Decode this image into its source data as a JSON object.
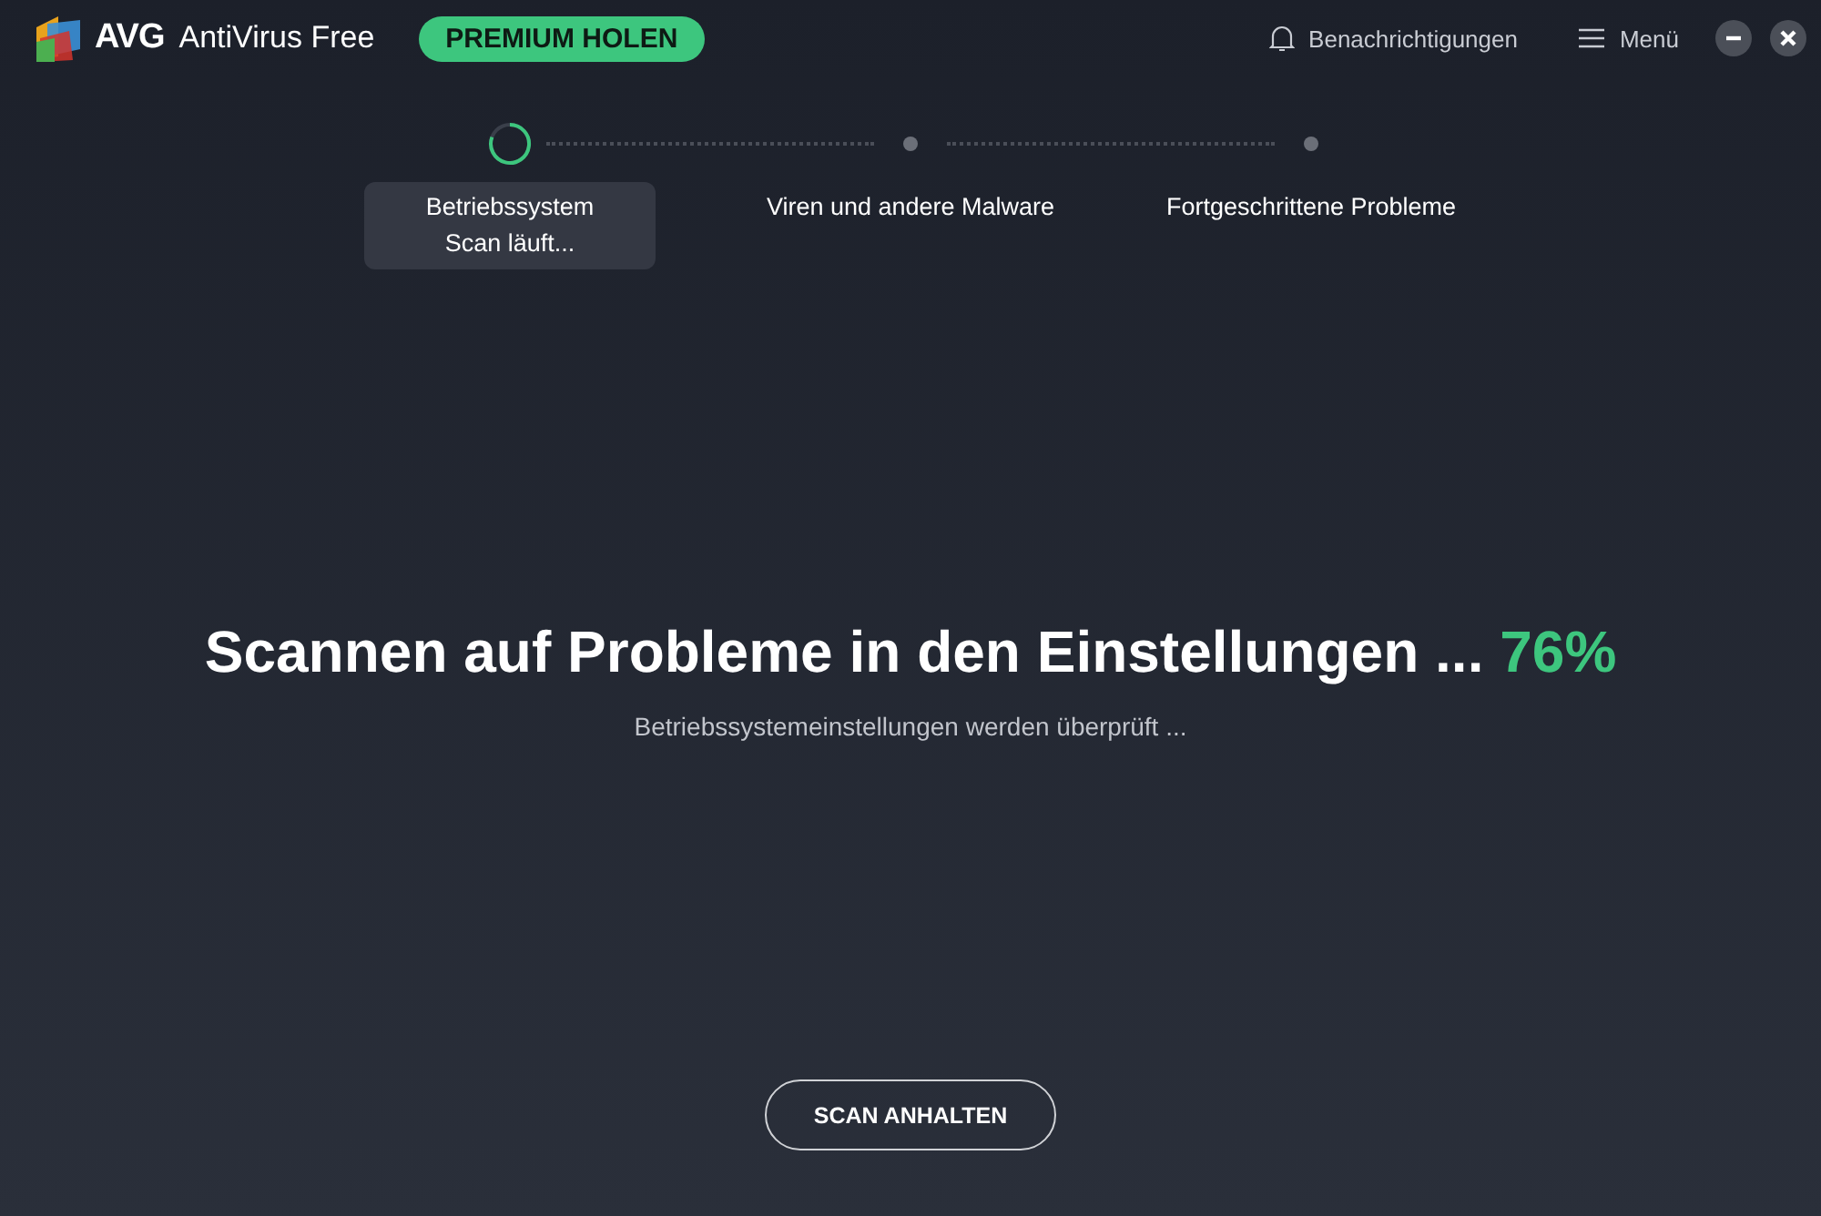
{
  "header": {
    "brand": "AVG",
    "product": "AntiVirus Free",
    "premium_button": "PREMIUM HOLEN",
    "notifications": "Benachrichtigungen",
    "menu": "Menü"
  },
  "steps": [
    {
      "label": "Betriebssystem",
      "status": "Scan läuft...",
      "selected": true
    },
    {
      "label": "Viren und andere Malware",
      "selected": false
    },
    {
      "label": "Fortgeschrittene Probleme",
      "selected": false
    }
  ],
  "scan": {
    "title": "Scannen auf Probleme in den Einstellungen ...",
    "percent": "76%",
    "subtitle": "Betriebssystemeinstellungen werden überprüft ..."
  },
  "stop_button": "SCAN ANHALTEN"
}
